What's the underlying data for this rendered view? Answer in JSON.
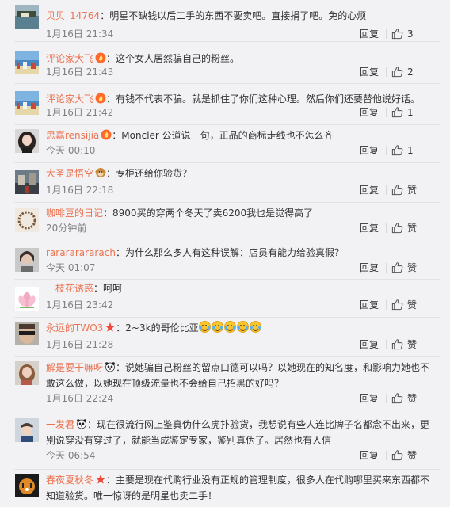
{
  "comments": [
    {
      "user": "贝贝_14764",
      "text": "明星不缺钱以后二手的东西不要卖吧。直接捐了吧。免的心烦",
      "time": "1月16日 21:34",
      "reply_label": "回复",
      "like_label": "3",
      "avatar_icon": "lake-photo-avatar",
      "badge": ""
    },
    {
      "user": "评论家大飞",
      "text": "这个女人居然骗自己的粉丝。",
      "time": "1月16日 21:43",
      "reply_label": "回复",
      "like_label": "2",
      "avatar_icon": "coast-photo-avatar",
      "badge": "flame-badge-icon"
    },
    {
      "user": "评论家大飞",
      "text": "有钱不代表不骗。就是抓住了你们这种心理。然后你们还要替他说好话。",
      "time": "1月16日 21:42",
      "reply_label": "回复",
      "like_label": "1",
      "avatar_icon": "coast-photo-avatar",
      "badge": "flame-badge-icon"
    },
    {
      "user": "思嘉rensijia",
      "text": "Moncler 公道说一句，正品的商标走线也不怎么齐",
      "time": "今天 00:10",
      "reply_label": "回复",
      "like_label": "1",
      "avatar_icon": "girl-photo-avatar",
      "badge": "flame-badge-icon"
    },
    {
      "user": "大圣是悟空",
      "text": "专柜还给你验货？",
      "time": "1月16日 22:18",
      "reply_label": "回复",
      "like_label": "赞",
      "avatar_icon": "street-photo-avatar",
      "badge": "monkey-badge-icon"
    },
    {
      "user": "咖啡豆的日记",
      "text": "8900买的穿两个冬天了卖6200我也是觉得高了",
      "time": "20分钟前",
      "reply_label": "回复",
      "like_label": "赞",
      "avatar_icon": "bracelet-photo-avatar",
      "badge": ""
    },
    {
      "user": "rarararararach",
      "text": "为什么那么多人有这种误解：店员有能力给验真假？",
      "time": "今天 01:07",
      "reply_label": "回复",
      "like_label": "赞",
      "avatar_icon": "portrait-photo-avatar",
      "badge": ""
    },
    {
      "user": "一枝花诱惑",
      "text": "呵呵",
      "time": "1月16日 23:42",
      "reply_label": "回复",
      "like_label": "赞",
      "avatar_icon": "lotus-photo-avatar",
      "badge": ""
    },
    {
      "user": "永远的TWO3",
      "text": "2~3k的哥伦比亚",
      "time": "1月16日 21:28",
      "reply_label": "回复",
      "like_label": "赞",
      "avatar_icon": "sunglasses-photo-avatar",
      "badge": "star-badge-icon",
      "emoji_count": 5,
      "emoji_icon": "laugh-cry-emoji-icon"
    },
    {
      "user": "解是要干嘛呀",
      "text": "说她骗自己粉丝的留点口德可以吗？以她现在的知名度，和影响力她也不敢这么做，以她现在顶级流量也不会给自己招黑的好吗？",
      "time": "1月16日 22:24",
      "reply_label": "回复",
      "like_label": "赞",
      "avatar_icon": "woman-photo-avatar",
      "badge": "panda-badge-icon"
    },
    {
      "user": "一发君",
      "text": "现在很流行网上鉴真伪什么虎扑验货，我想说有些人连比牌子名都念不出来，更别说穿没有穿过了，就能当成鉴定专家，鉴别真伪了。居然也有人信",
      "time": "今天 06:54",
      "reply_label": "回复",
      "like_label": "赞",
      "avatar_icon": "boy-photo-avatar",
      "badge": "panda-badge-icon"
    },
    {
      "user": "春夜夏秋冬",
      "text": "主要是现在代购行业没有正规的管理制度，很多人在代购哪里买来东西都不知道验货。唯一惊讶的是明星也卖二手！",
      "time": "",
      "reply_label": "",
      "like_label": "",
      "avatar_icon": "tiger-photo-avatar",
      "badge": "star-badge-icon"
    }
  ],
  "colors": {
    "username": "#eb7350",
    "time": "#808080",
    "text": "#333333",
    "background": "#f2f2f5"
  }
}
